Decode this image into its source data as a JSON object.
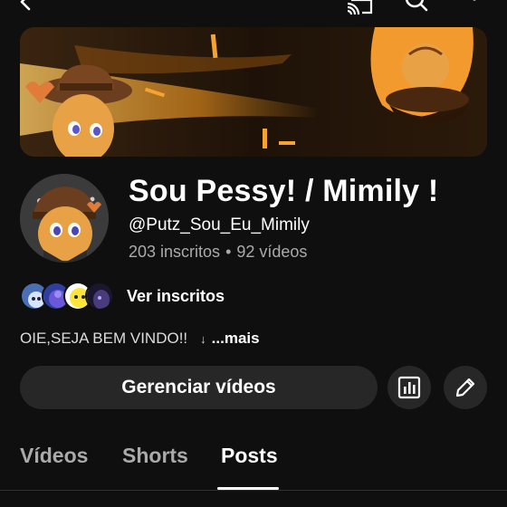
{
  "topbar": {
    "icons": [
      "back-arrow-icon",
      "cast-icon",
      "search-icon",
      "more-vert-icon"
    ]
  },
  "channel": {
    "name": "Sou Pessy! / Mimily !",
    "handle": "@Putz_Sou_Eu_Mimily",
    "subscribers": "203 inscritos",
    "separator": "•",
    "videos": "92 vídeos"
  },
  "subscribers_row": {
    "label": "Ver inscritos"
  },
  "description": {
    "text": "OIE,SEJA BEM VINDO!!",
    "more_arrow": "↓",
    "more_label": "...mais"
  },
  "actions": {
    "manage_label": "Gerenciar vídeos",
    "stats_icon": "bar-chart-icon",
    "edit_icon": "pencil-icon"
  },
  "tabs": [
    {
      "label": "Vídeos",
      "active": false
    },
    {
      "label": "Shorts",
      "active": false
    },
    {
      "label": "Posts",
      "active": true
    }
  ],
  "colors": {
    "background": "#0f0f0f",
    "button": "#272727",
    "text_secondary": "#aaaaaa",
    "banner_accent": "#f29a2e"
  }
}
